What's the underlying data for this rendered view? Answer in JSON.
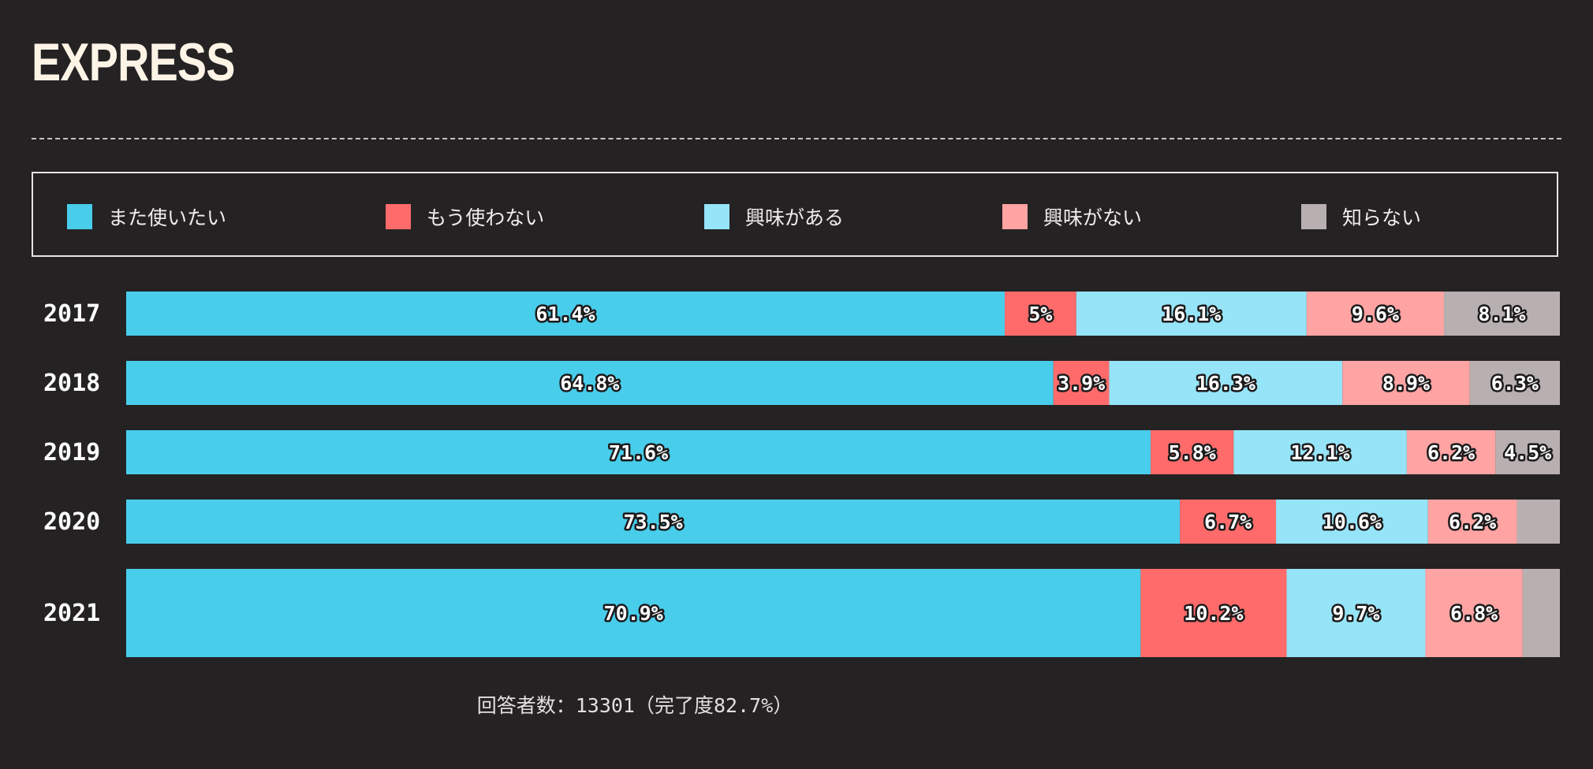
{
  "title": "EXPRESS",
  "legend": [
    {
      "label": "また使いたい",
      "color": "#48cdeb"
    },
    {
      "label": "もう使わない",
      "color": "#ff6b6b"
    },
    {
      "label": "興味がある",
      "color": "#96e4f8"
    },
    {
      "label": "興味がない",
      "color": "#ffa3a3"
    },
    {
      "label": "知らない",
      "color": "#b8afb1"
    }
  ],
  "footer": {
    "prefix": "回答者数：",
    "count": "13301",
    "paren_open": "（完了度",
    "percent": "82.7%",
    "paren_close": "）"
  },
  "chart_data": {
    "type": "bar",
    "orientation": "horizontal",
    "stacked": true,
    "unit": "%",
    "categories": [
      "2017",
      "2018",
      "2019",
      "2020",
      "2021"
    ],
    "series": [
      {
        "name": "また使いたい",
        "color": "#48cdeb",
        "values": [
          61.4,
          64.8,
          71.6,
          73.5,
          70.9
        ],
        "labels": [
          "61.4%",
          "64.8%",
          "71.6%",
          "73.5%",
          "70.9%"
        ]
      },
      {
        "name": "もう使わない",
        "color": "#ff6b6b",
        "values": [
          5,
          3.9,
          5.8,
          6.7,
          10.2
        ],
        "labels": [
          "5%",
          "3.9%",
          "5.8%",
          "6.7%",
          "10.2%"
        ]
      },
      {
        "name": "興味がある",
        "color": "#96e4f8",
        "values": [
          16.1,
          16.3,
          12.1,
          10.6,
          9.7
        ],
        "labels": [
          "16.1%",
          "16.3%",
          "12.1%",
          "10.6%",
          "9.7%"
        ]
      },
      {
        "name": "興味がない",
        "color": "#ffa3a3",
        "values": [
          9.6,
          8.9,
          6.2,
          6.2,
          6.8
        ],
        "labels": [
          "9.6%",
          "8.9%",
          "6.2%",
          "6.2%",
          "6.8%"
        ]
      },
      {
        "name": "知らない",
        "color": "#b8afb1",
        "values": [
          8.1,
          6.3,
          4.5,
          3.0,
          2.6
        ],
        "labels": [
          "8.1%",
          "6.3%",
          "4.5%",
          "",
          ""
        ]
      }
    ],
    "xlim": [
      0,
      100
    ]
  }
}
